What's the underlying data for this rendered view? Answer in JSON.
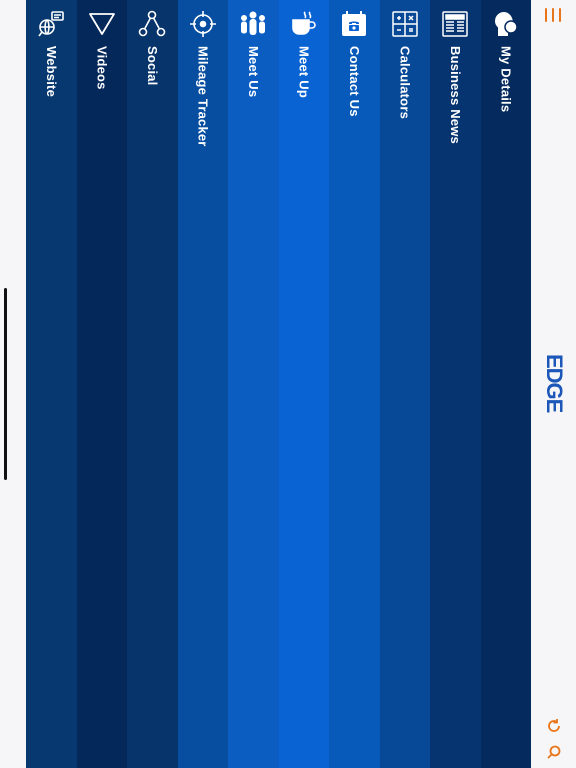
{
  "menu": {
    "items": [
      {
        "label": "Website",
        "icon": "website-globe-icon",
        "color": "#07386f"
      },
      {
        "label": "Videos",
        "icon": "play-triangle-icon",
        "color": "#05285a"
      },
      {
        "label": "Social",
        "icon": "share-nodes-icon",
        "color": "#08346c"
      },
      {
        "label": "Mileage Tracker",
        "icon": "crosshair-target-icon",
        "color": "#074ea0"
      },
      {
        "label": "Meet Us",
        "icon": "people-group-icon",
        "color": "#0b5dc2"
      },
      {
        "label": "Meet Up",
        "icon": "coffee-cup-icon",
        "color": "#0963d3"
      },
      {
        "label": "Contact Us",
        "icon": "phone-calendar-icon",
        "color": "#075ab9"
      },
      {
        "label": "Calculators",
        "icon": "calculator-icon",
        "color": "#074997"
      },
      {
        "label": "Business News",
        "icon": "newspaper-icon",
        "color": "#063470"
      },
      {
        "label": "My Details",
        "icon": "profile-head-icon",
        "color": "#052b5e"
      }
    ]
  },
  "toolbar": {
    "logo_text": "EDGE",
    "accent_color": "#e8751a",
    "logo_color": "#1b56b8"
  }
}
